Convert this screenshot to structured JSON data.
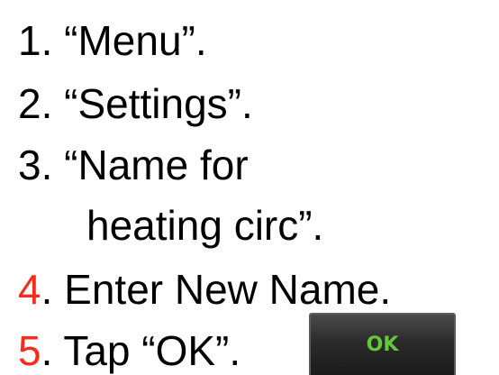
{
  "steps": [
    {
      "number": "1.",
      "text": " “Menu”."
    },
    {
      "number": "2.",
      "text": " “Settings”."
    },
    {
      "number": "3.",
      "text": " “Name for"
    },
    {
      "number": "",
      "text": "heating circ”."
    },
    {
      "number": "4",
      "after_number": ".",
      "text": " Enter New Name."
    },
    {
      "number": "5",
      "after_number": ".",
      "text": " Tap “OK”."
    }
  ],
  "ok_button": {
    "label": "OK"
  },
  "colors": {
    "highlight_number": "#ff2a1a",
    "ok_text": "#62c93a",
    "ok_bg": "#2b2b2b"
  }
}
